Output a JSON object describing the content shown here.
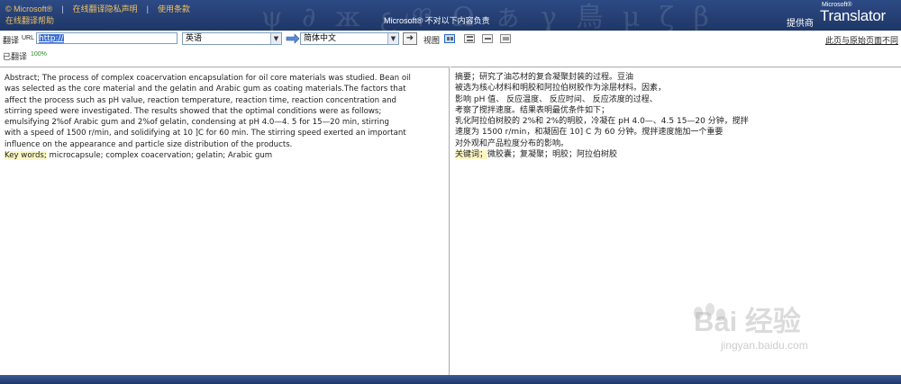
{
  "banner": {
    "brand": "© Microsoft®",
    "privacy_link": "在线翻译隐私声明",
    "terms_link": "使用条款",
    "help_link": "在线翻译帮助",
    "disclaimer": "Microsoft® 不对以下内容负责",
    "provider_label": "提供商",
    "logo_small": "Microsoft®",
    "logo_main": "Translator"
  },
  "toolbar": {
    "translate_label": "翻译",
    "url_label": "URL",
    "url_value": "http://",
    "source_lang": "英语",
    "target_lang": "简体中文",
    "go_label": "➜",
    "view_label": "视图",
    "right_link": "此页与原始页面不同",
    "translated_label": "已翻译",
    "progress_pct": "100%"
  },
  "source": {
    "lines": [
      "Abstract; The process of complex coacervation encapsulation for oil core materials was studied. Bean oil",
      "was selected as the core material and the gelatin and Arabic gum as coating materials.The factors that",
      "affect the process such as pH value, reaction temperature, reaction time, reaction concentration and",
      "stirring speed were investigated. The results showed that the optimal conditions were as follows;",
      "emulsifying 2%of Arabic gum and 2%of gelatin, condensing at pH 4.0—4. 5 for 15—20 min, stirring",
      "with a speed of 1500 r/min, and solidifying at 10 ]C for 60 min. The stirring speed exerted an important",
      "influence on the appearance and particle size distribution of the products."
    ],
    "keywords_label": "Key words;",
    "keywords": " microcapsule; complex coacervation; gelatin; Arabic gum"
  },
  "target": {
    "lines": [
      "摘要；研究了油芯材的复合凝聚封装的过程。豆油",
      "被选为核心材料和明胶和阿拉伯树胶作为涂层材料。因素，",
      "影响 pH 值、 反应温度、 反应时间、 反应浓度的过程、",
      "考察了搅拌速度。结果表明最优条件如下；",
      "乳化阿拉伯树胶的 2%和 2%的明胶，冷凝在 pH 4.0—、4.5 15—20 分钟，搅拌",
      "速度为 1500 r/min，和凝固在 10] C 为 60 分钟。搅拌速度施加一个重要",
      "对外观和产品粒度分布的影响。"
    ],
    "keywords_label": "关键词；",
    "keywords": "微胶囊；复凝聚；明胶；阿拉伯树胶"
  },
  "watermark": {
    "text": "Bai 经验",
    "url": "jingyan.baidu.com"
  },
  "colors": {
    "banner": "#243f74",
    "accent_link": "#f0c060",
    "highlight": "#fdf7c3"
  },
  "icons": [
    "swap-arrow-icon",
    "go-arrow-icon",
    "view-side-by-side-icon",
    "view-top-bottom-icon",
    "view-hover-icon",
    "view-original-icon"
  ]
}
